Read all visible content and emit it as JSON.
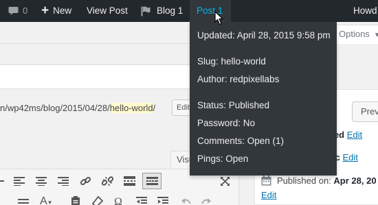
{
  "admin_bar": {
    "comments_count": "0",
    "new_label": "New",
    "view_post_label": "View Post",
    "blog_label": "Blog 1",
    "post_label": "Post 1",
    "howdy_label": "Howd"
  },
  "screen_options": {
    "label": "Options"
  },
  "permalink": {
    "prefix": "n/wp42ms/blog/2015/04/28/",
    "slug": "hello-world",
    "suffix": "/",
    "edit_label": "Edit"
  },
  "editor": {
    "visual_tab": "Visu"
  },
  "publish": {
    "preview_label": "Prev",
    "status_suffix": "hed",
    "status_edit": "Edit",
    "visibility_suffix": "ic",
    "visibility_edit": "Edit",
    "published_label": "Published on:",
    "published_date": "Apr 28, 20",
    "published_edit": "Edit"
  },
  "dropdown": {
    "updated": "Updated: April 28, 2015 9:58 pm",
    "slug": "Slug: hello-world",
    "author": "Author: redpixellabs",
    "status": "Status: Published",
    "password": "Password: No",
    "comments": "Comments: Open (1)",
    "pings": "Pings: Open"
  },
  "colors": {
    "admin_bar_bg": "#23282d",
    "dropdown_bg": "#32373c",
    "active_link": "#00b9eb",
    "link": "#0073aa",
    "slug_highlight": "#fffbcc"
  },
  "icons": [
    "comment-bubble-icon",
    "plus-icon",
    "flag-icon",
    "cursor-icon",
    "calendar-icon"
  ]
}
